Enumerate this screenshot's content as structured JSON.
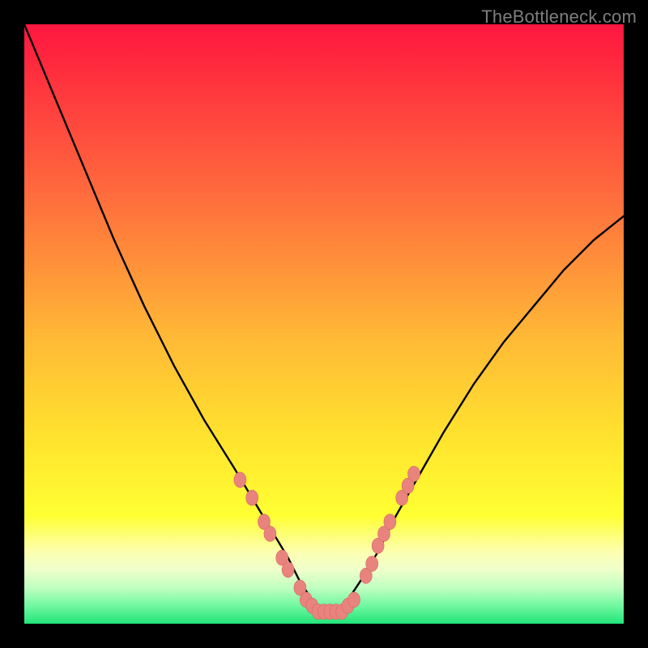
{
  "watermark": "TheBottleneck.com",
  "colors": {
    "black_frame": "#000000",
    "gradient_top": "#ff163f",
    "gradient_mid1": "#ff7a3a",
    "gradient_mid2": "#ffd430",
    "gradient_mid3": "#ffff33",
    "gradient_low1": "#e8ff70",
    "gradient_low2": "#9fff9f",
    "gradient_bottom": "#22e579",
    "curve": "#000000",
    "marker_fill": "#e9837e",
    "marker_stroke": "#d46a64"
  },
  "chart_data": {
    "type": "line",
    "title": "",
    "xlabel": "",
    "ylabel": "",
    "xlim": [
      0,
      100
    ],
    "ylim": [
      0,
      100
    ],
    "series": [
      {
        "name": "bottleneck-curve",
        "x": [
          0,
          5,
          10,
          15,
          20,
          25,
          30,
          35,
          38,
          41,
          44,
          46,
          48,
          50,
          52,
          54,
          56,
          59,
          62,
          66,
          70,
          75,
          80,
          85,
          90,
          95,
          100
        ],
        "y": [
          100,
          88,
          76,
          64,
          53,
          43,
          34,
          26,
          21,
          16,
          11,
          7,
          4,
          2,
          2,
          4,
          7,
          12,
          18,
          25,
          32,
          40,
          47,
          53,
          59,
          64,
          68
        ]
      }
    ],
    "markers": {
      "name": "highlighted-points",
      "points": [
        {
          "x": 36,
          "y": 24
        },
        {
          "x": 38,
          "y": 21
        },
        {
          "x": 40,
          "y": 17
        },
        {
          "x": 41,
          "y": 15
        },
        {
          "x": 43,
          "y": 11
        },
        {
          "x": 44,
          "y": 9
        },
        {
          "x": 46,
          "y": 6
        },
        {
          "x": 47,
          "y": 4
        },
        {
          "x": 48,
          "y": 3
        },
        {
          "x": 49,
          "y": 2
        },
        {
          "x": 50,
          "y": 2
        },
        {
          "x": 51,
          "y": 2
        },
        {
          "x": 52,
          "y": 2
        },
        {
          "x": 53,
          "y": 2
        },
        {
          "x": 54,
          "y": 3
        },
        {
          "x": 55,
          "y": 4
        },
        {
          "x": 57,
          "y": 8
        },
        {
          "x": 58,
          "y": 10
        },
        {
          "x": 59,
          "y": 13
        },
        {
          "x": 60,
          "y": 15
        },
        {
          "x": 61,
          "y": 17
        },
        {
          "x": 63,
          "y": 21
        },
        {
          "x": 64,
          "y": 23
        },
        {
          "x": 65,
          "y": 25
        }
      ]
    }
  }
}
